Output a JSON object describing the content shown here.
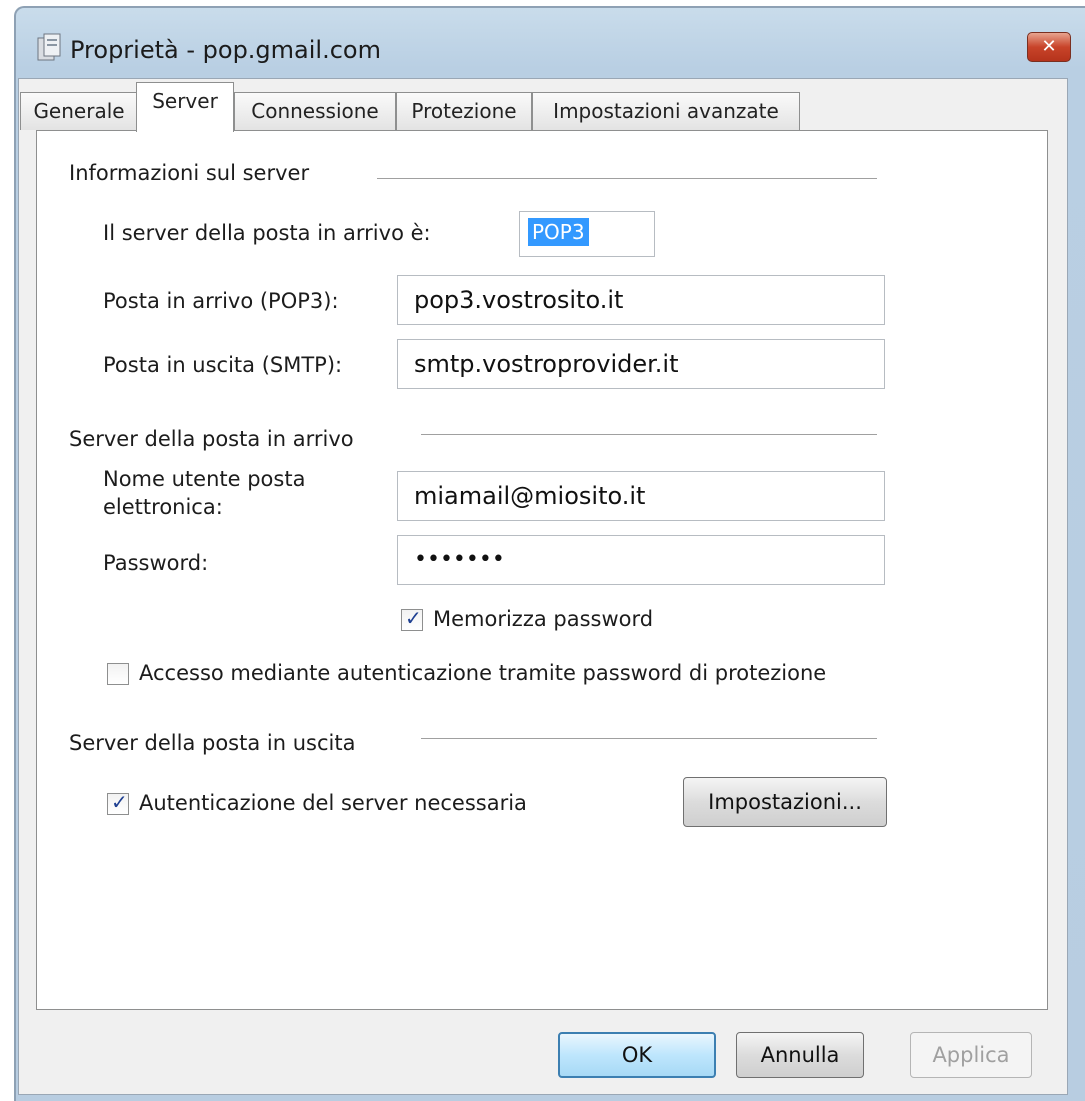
{
  "window": {
    "title": "Proprietà - pop.gmail.com",
    "close_label": "✕"
  },
  "tabs": [
    {
      "label": "Generale"
    },
    {
      "label": "Server"
    },
    {
      "label": "Connessione"
    },
    {
      "label": "Protezione"
    },
    {
      "label": "Impostazioni avanzate"
    }
  ],
  "active_tab": "Server",
  "server_info": {
    "title": "Informazioni sul server",
    "incoming_type_label": "Il server della posta in arrivo è:",
    "incoming_type_value": "POP3",
    "incoming_label": "Posta in arrivo (POP3):",
    "incoming_value": "pop3.vostrosito.it",
    "outgoing_label": "Posta in uscita (SMTP):",
    "outgoing_value": "smtp.vostroprovider.it"
  },
  "incoming_server": {
    "title": "Server della posta in arrivo",
    "username_label_line1": "Nome utente posta",
    "username_label_line2": "elettronica:",
    "username_value": "miamail@miosito.it",
    "password_label": "Password:",
    "password_value": "•••••••",
    "remember_label": "Memorizza password",
    "remember_checked": true,
    "spa_label": "Accesso mediante autenticazione tramite password di protezione",
    "spa_checked": false
  },
  "outgoing_server": {
    "title": "Server della posta in uscita",
    "auth_label": "Autenticazione del server necessaria",
    "auth_checked": true,
    "settings_button": "Impostazioni..."
  },
  "buttons": {
    "ok": "OK",
    "cancel": "Annulla",
    "apply": "Applica"
  },
  "colors": {
    "selection": "#3399ff",
    "check": "#1e3f91",
    "close_button": "#c8442a"
  }
}
